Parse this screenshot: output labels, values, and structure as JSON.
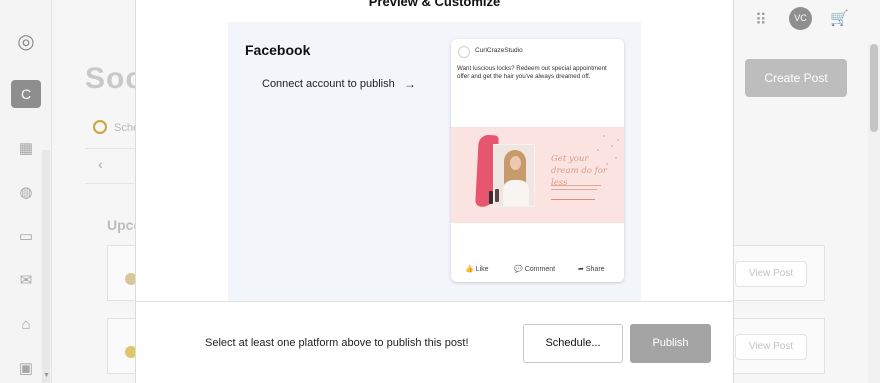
{
  "background": {
    "page_title": "Soc",
    "schedule_tab_label": "Sche",
    "upcoming_label": "Upco",
    "avatar_initials": "VC",
    "create_post_label": "Create Post",
    "view_post_label": "View Post",
    "workspace_badge": "C"
  },
  "modal": {
    "title": "Preview & Customize",
    "platform": {
      "name": "Facebook",
      "connect_label": "Connect account to publish",
      "connect_arrow": "→"
    },
    "post_preview": {
      "page_name": "CurlCrazeStudio",
      "text": "Want luscious locks? Redeem out special appointment offer and get the hair you've always dreamed off.",
      "image_headline": "Get your dream do for less",
      "actions": [
        {
          "label": "Like",
          "icon": "thumbs-up-icon",
          "glyph": "👍"
        },
        {
          "label": "Comment",
          "icon": "comment-icon",
          "glyph": "💬"
        },
        {
          "label": "Share",
          "icon": "share-icon",
          "glyph": "➦"
        }
      ]
    },
    "footer": {
      "hint": "Select at least one platform above to publish this post!",
      "schedule_label": "Schedule...",
      "publish_label": "Publish"
    }
  },
  "colors": {
    "brand_pink": "#e8556f",
    "preview_bg": "#f2f6fb",
    "publish_disabled": "#a4a4a4"
  }
}
